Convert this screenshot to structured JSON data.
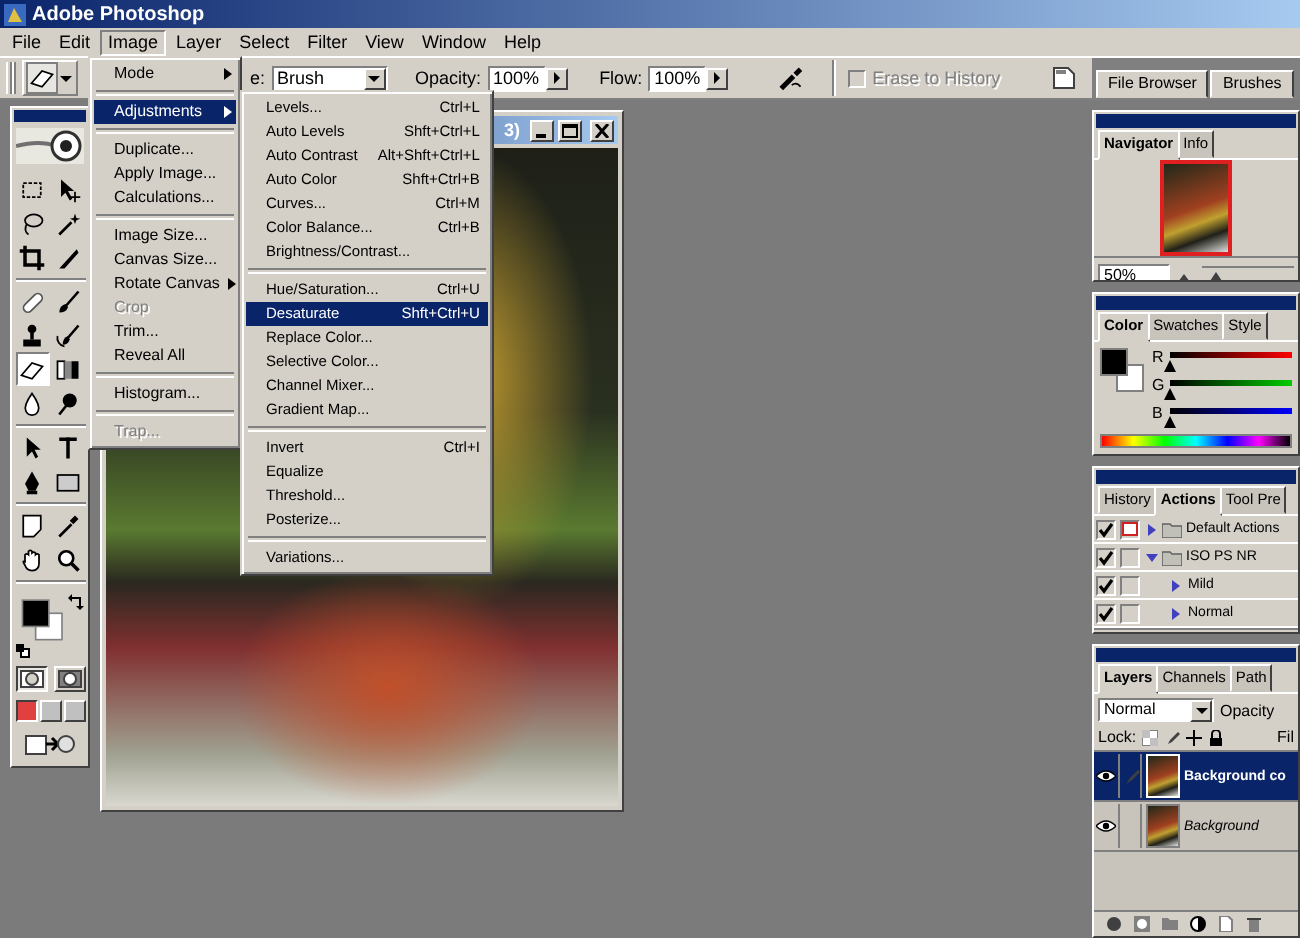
{
  "window": {
    "title": "Adobe Photoshop"
  },
  "menu_bar": [
    {
      "label": "File",
      "selected": false
    },
    {
      "label": "Edit",
      "selected": false
    },
    {
      "label": "Image",
      "selected": true
    },
    {
      "label": "Layer",
      "selected": false
    },
    {
      "label": "Select",
      "selected": false
    },
    {
      "label": "Filter",
      "selected": false
    },
    {
      "label": "View",
      "selected": false
    },
    {
      "label": "Window",
      "selected": false
    },
    {
      "label": "Help",
      "selected": false
    }
  ],
  "options_bar": {
    "mode_label": "e:",
    "mode": "Brush",
    "opacity_label": "Opacity:",
    "opacity": "100%",
    "flow_label": "Flow:",
    "flow": "100%",
    "erase_to_history": {
      "label": "Erase to History",
      "checked": false,
      "disabled": true
    }
  },
  "palette_well": {
    "tabs": [
      {
        "label": "File Browser",
        "selected": false
      },
      {
        "label": "Brushes",
        "selected": false
      }
    ]
  },
  "image_menu": {
    "sections": [
      [
        {
          "label": "Mode",
          "submenu": true,
          "disabled": false,
          "selected": false
        }
      ],
      [
        {
          "label": "Adjustments",
          "submenu": true,
          "disabled": false,
          "selected": true
        }
      ],
      [
        {
          "label": "Duplicate...",
          "submenu": false,
          "disabled": false,
          "selected": false
        },
        {
          "label": "Apply Image...",
          "submenu": false,
          "disabled": false,
          "selected": false
        },
        {
          "label": "Calculations...",
          "submenu": false,
          "disabled": false,
          "selected": false
        }
      ],
      [
        {
          "label": "Image Size...",
          "submenu": false,
          "disabled": false,
          "selected": false
        },
        {
          "label": "Canvas Size...",
          "submenu": false,
          "disabled": false,
          "selected": false
        },
        {
          "label": "Rotate Canvas",
          "submenu": true,
          "disabled": false,
          "selected": false
        },
        {
          "label": "Crop",
          "submenu": false,
          "disabled": true,
          "selected": false
        },
        {
          "label": "Trim...",
          "submenu": false,
          "disabled": false,
          "selected": false
        },
        {
          "label": "Reveal All",
          "submenu": false,
          "disabled": false,
          "selected": false
        }
      ],
      [
        {
          "label": "Histogram...",
          "submenu": false,
          "disabled": false,
          "selected": false
        }
      ],
      [
        {
          "label": "Trap...",
          "submenu": false,
          "disabled": true,
          "selected": false
        }
      ]
    ]
  },
  "adjustments_menu": {
    "sections": [
      [
        {
          "label": "Levels...",
          "shortcut": "Ctrl+L",
          "submenu": false,
          "disabled": false,
          "selected": false
        },
        {
          "label": "Auto Levels",
          "shortcut": "Shft+Ctrl+L",
          "submenu": false,
          "disabled": false,
          "selected": false
        },
        {
          "label": "Auto Contrast",
          "shortcut": "Alt+Shft+Ctrl+L",
          "submenu": false,
          "disabled": false,
          "selected": false
        },
        {
          "label": "Auto Color",
          "shortcut": "Shft+Ctrl+B",
          "submenu": false,
          "disabled": false,
          "selected": false
        },
        {
          "label": "Curves...",
          "shortcut": "Ctrl+M",
          "submenu": false,
          "disabled": false,
          "selected": false
        },
        {
          "label": "Color Balance...",
          "shortcut": "Ctrl+B",
          "submenu": false,
          "disabled": false,
          "selected": false
        },
        {
          "label": "Brightness/Contrast...",
          "submenu": false,
          "disabled": false,
          "selected": false
        }
      ],
      [
        {
          "label": "Hue/Saturation...",
          "shortcut": "Ctrl+U",
          "submenu": false,
          "disabled": false,
          "selected": false
        },
        {
          "label": "Desaturate",
          "shortcut": "Shft+Ctrl+U",
          "submenu": false,
          "disabled": false,
          "selected": true
        },
        {
          "label": "Replace Color...",
          "submenu": false,
          "disabled": false,
          "selected": false
        },
        {
          "label": "Selective Color...",
          "submenu": false,
          "disabled": false,
          "selected": false
        },
        {
          "label": "Channel Mixer...",
          "submenu": false,
          "disabled": false,
          "selected": false
        },
        {
          "label": "Gradient Map...",
          "submenu": false,
          "disabled": false,
          "selected": false
        }
      ],
      [
        {
          "label": "Invert",
          "shortcut": "Ctrl+I",
          "submenu": false,
          "disabled": false,
          "selected": false
        },
        {
          "label": "Equalize",
          "submenu": false,
          "disabled": false,
          "selected": false
        },
        {
          "label": "Threshold...",
          "submenu": false,
          "disabled": false,
          "selected": false
        },
        {
          "label": "Posterize...",
          "submenu": false,
          "disabled": false,
          "selected": false
        }
      ],
      [
        {
          "label": "Variations...",
          "submenu": false,
          "disabled": false,
          "selected": false
        }
      ]
    ]
  },
  "document": {
    "title": "3)"
  },
  "toolbox": {
    "groups": [
      [
        {
          "kind": "marquee",
          "selected": false
        },
        {
          "kind": "move",
          "selected": false
        },
        {
          "kind": "lasso",
          "selected": false
        },
        {
          "kind": "wand",
          "selected": false
        },
        {
          "kind": "crop",
          "selected": false
        },
        {
          "kind": "slice",
          "selected": false
        }
      ],
      [
        {
          "kind": "healing",
          "selected": false
        },
        {
          "kind": "brush",
          "selected": false
        },
        {
          "kind": "stamp",
          "selected": false
        },
        {
          "kind": "history",
          "selected": false
        },
        {
          "kind": "eraser",
          "selected": true
        },
        {
          "kind": "gradient",
          "selected": false
        },
        {
          "kind": "blur",
          "selected": false
        },
        {
          "kind": "dodge",
          "selected": false
        }
      ],
      [
        {
          "kind": "select",
          "selected": false
        },
        {
          "kind": "type",
          "selected": false
        },
        {
          "kind": "pen",
          "selected": false
        },
        {
          "kind": "shape",
          "selected": false
        }
      ],
      [
        {
          "kind": "notes",
          "selected": false
        },
        {
          "kind": "eyedropper",
          "selected": false
        },
        {
          "kind": "hand",
          "selected": false
        },
        {
          "kind": "zoom",
          "selected": false
        }
      ]
    ],
    "mask_modes": [
      {
        "selected": true
      },
      {
        "selected": false
      }
    ],
    "screen_modes": [
      {
        "selected": true
      },
      {
        "selected": false
      },
      {
        "selected": false
      }
    ]
  },
  "navigator": {
    "tabs": [
      {
        "label": "Navigator",
        "selected": true
      },
      {
        "label": "Info",
        "selected": false
      }
    ],
    "zoom": "50%",
    "level": 0.15
  },
  "color": {
    "tabs": [
      {
        "label": "Color",
        "selected": true
      },
      {
        "label": "Swatches",
        "selected": false
      },
      {
        "label": "Style",
        "selected": false
      }
    ],
    "sliders": [
      {
        "label": "R",
        "level": 0
      },
      {
        "label": "G",
        "level": 0
      },
      {
        "label": "B",
        "level": 0
      }
    ]
  },
  "actions": {
    "tabs": [
      {
        "label": "History",
        "selected": false
      },
      {
        "label": "Actions",
        "selected": true
      },
      {
        "label": "Tool Pre",
        "selected": false
      }
    ],
    "items": [
      {
        "name": "Default Actions",
        "kind": "set",
        "included": true,
        "dialog": true,
        "expanded": false
      },
      {
        "name": "ISO PS NR",
        "kind": "set",
        "included": true,
        "dialog": false,
        "expanded": true,
        "children": [
          {
            "name": "Mild",
            "kind": "action",
            "included": true,
            "dialog": false,
            "expanded": false
          },
          {
            "name": "Normal",
            "kind": "action",
            "included": true,
            "dialog": false,
            "expanded": false
          }
        ]
      }
    ]
  },
  "layers": {
    "tabs": [
      {
        "label": "Layers",
        "selected": true
      },
      {
        "label": "Channels",
        "selected": false
      },
      {
        "label": "Path",
        "selected": false
      }
    ],
    "blend_mode": "Normal",
    "opacity_label": "Opacity",
    "lock_label": "Lock:",
    "fill_label": "Fil",
    "items": [
      {
        "name": "Background co",
        "kind": "layer",
        "visible": true,
        "selected": true
      },
      {
        "name": "Background",
        "kind": "background",
        "visible": true,
        "selected": false
      }
    ]
  }
}
